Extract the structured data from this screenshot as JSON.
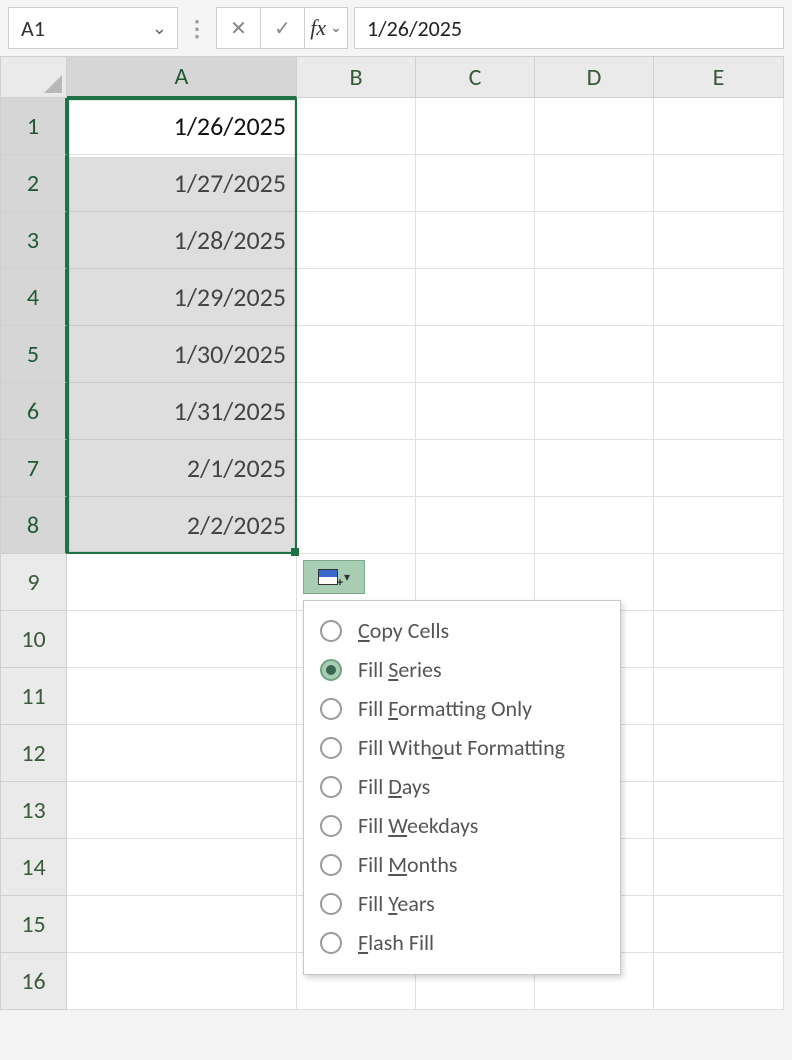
{
  "formula_bar": {
    "name_box": "A1",
    "formula_value": "1/26/2025"
  },
  "columns": [
    "A",
    "B",
    "C",
    "D",
    "E"
  ],
  "rows": [
    "1",
    "2",
    "3",
    "4",
    "5",
    "6",
    "7",
    "8",
    "9",
    "10",
    "11",
    "12",
    "13",
    "14",
    "15",
    "16"
  ],
  "selected_column_index": 0,
  "selected_row_start": 0,
  "selected_row_end": 7,
  "cells_colA": [
    "1/26/2025",
    "1/27/2025",
    "1/28/2025",
    "1/29/2025",
    "1/30/2025",
    "1/31/2025",
    "2/1/2025",
    "2/2/2025",
    "",
    "",
    "",
    "",
    "",
    "",
    "",
    ""
  ],
  "autofill_menu": {
    "selected_index": 1,
    "items": [
      {
        "pre": "",
        "u": "C",
        "post": "opy Cells"
      },
      {
        "pre": "Fill ",
        "u": "S",
        "post": "eries"
      },
      {
        "pre": "Fill ",
        "u": "F",
        "post": "ormatting Only"
      },
      {
        "pre": "Fill With",
        "u": "o",
        "post": "ut Formatting"
      },
      {
        "pre": "Fill ",
        "u": "D",
        "post": "ays"
      },
      {
        "pre": "Fill ",
        "u": "W",
        "post": "eekdays"
      },
      {
        "pre": "Fill ",
        "u": "M",
        "post": "onths"
      },
      {
        "pre": "Fill ",
        "u": "Y",
        "post": "ears"
      },
      {
        "pre": "",
        "u": "F",
        "post": "lash Fill"
      }
    ]
  }
}
